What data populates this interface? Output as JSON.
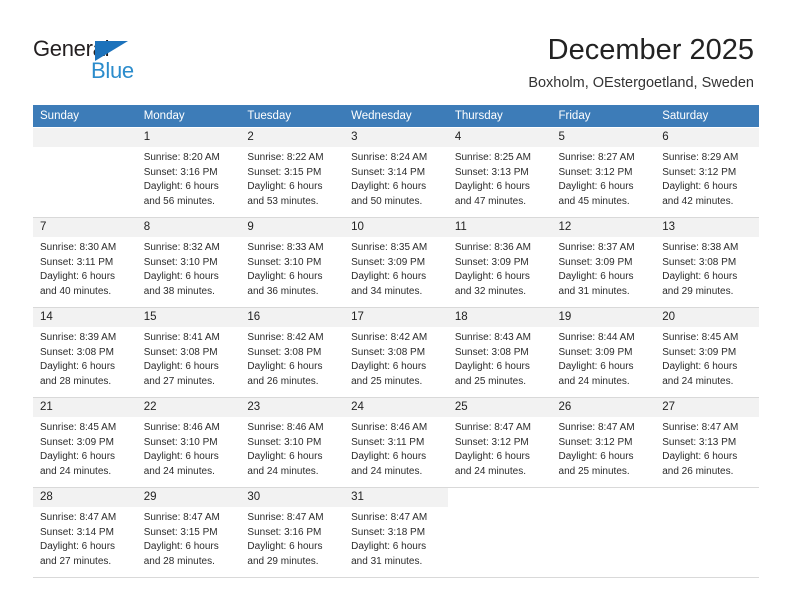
{
  "logo": {
    "text_general": "General",
    "text_blue": "Blue",
    "accent_color": "#1c72bb",
    "blue_text_color": "#2b8ccc"
  },
  "header": {
    "title": "December 2025",
    "subtitle": "Boxholm, OEstergoetland, Sweden"
  },
  "calendar": {
    "header_bg": "#3d7cb8",
    "daynum_bg": "#f2f2f2",
    "weekdays": [
      "Sunday",
      "Monday",
      "Tuesday",
      "Wednesday",
      "Thursday",
      "Friday",
      "Saturday"
    ],
    "weeks": [
      [
        {
          "day": "",
          "lines": []
        },
        {
          "day": "1",
          "lines": [
            "Sunrise: 8:20 AM",
            "Sunset: 3:16 PM",
            "Daylight: 6 hours",
            "and 56 minutes."
          ]
        },
        {
          "day": "2",
          "lines": [
            "Sunrise: 8:22 AM",
            "Sunset: 3:15 PM",
            "Daylight: 6 hours",
            "and 53 minutes."
          ]
        },
        {
          "day": "3",
          "lines": [
            "Sunrise: 8:24 AM",
            "Sunset: 3:14 PM",
            "Daylight: 6 hours",
            "and 50 minutes."
          ]
        },
        {
          "day": "4",
          "lines": [
            "Sunrise: 8:25 AM",
            "Sunset: 3:13 PM",
            "Daylight: 6 hours",
            "and 47 minutes."
          ]
        },
        {
          "day": "5",
          "lines": [
            "Sunrise: 8:27 AM",
            "Sunset: 3:12 PM",
            "Daylight: 6 hours",
            "and 45 minutes."
          ]
        },
        {
          "day": "6",
          "lines": [
            "Sunrise: 8:29 AM",
            "Sunset: 3:12 PM",
            "Daylight: 6 hours",
            "and 42 minutes."
          ]
        }
      ],
      [
        {
          "day": "7",
          "lines": [
            "Sunrise: 8:30 AM",
            "Sunset: 3:11 PM",
            "Daylight: 6 hours",
            "and 40 minutes."
          ]
        },
        {
          "day": "8",
          "lines": [
            "Sunrise: 8:32 AM",
            "Sunset: 3:10 PM",
            "Daylight: 6 hours",
            "and 38 minutes."
          ]
        },
        {
          "day": "9",
          "lines": [
            "Sunrise: 8:33 AM",
            "Sunset: 3:10 PM",
            "Daylight: 6 hours",
            "and 36 minutes."
          ]
        },
        {
          "day": "10",
          "lines": [
            "Sunrise: 8:35 AM",
            "Sunset: 3:09 PM",
            "Daylight: 6 hours",
            "and 34 minutes."
          ]
        },
        {
          "day": "11",
          "lines": [
            "Sunrise: 8:36 AM",
            "Sunset: 3:09 PM",
            "Daylight: 6 hours",
            "and 32 minutes."
          ]
        },
        {
          "day": "12",
          "lines": [
            "Sunrise: 8:37 AM",
            "Sunset: 3:09 PM",
            "Daylight: 6 hours",
            "and 31 minutes."
          ]
        },
        {
          "day": "13",
          "lines": [
            "Sunrise: 8:38 AM",
            "Sunset: 3:08 PM",
            "Daylight: 6 hours",
            "and 29 minutes."
          ]
        }
      ],
      [
        {
          "day": "14",
          "lines": [
            "Sunrise: 8:39 AM",
            "Sunset: 3:08 PM",
            "Daylight: 6 hours",
            "and 28 minutes."
          ]
        },
        {
          "day": "15",
          "lines": [
            "Sunrise: 8:41 AM",
            "Sunset: 3:08 PM",
            "Daylight: 6 hours",
            "and 27 minutes."
          ]
        },
        {
          "day": "16",
          "lines": [
            "Sunrise: 8:42 AM",
            "Sunset: 3:08 PM",
            "Daylight: 6 hours",
            "and 26 minutes."
          ]
        },
        {
          "day": "17",
          "lines": [
            "Sunrise: 8:42 AM",
            "Sunset: 3:08 PM",
            "Daylight: 6 hours",
            "and 25 minutes."
          ]
        },
        {
          "day": "18",
          "lines": [
            "Sunrise: 8:43 AM",
            "Sunset: 3:08 PM",
            "Daylight: 6 hours",
            "and 25 minutes."
          ]
        },
        {
          "day": "19",
          "lines": [
            "Sunrise: 8:44 AM",
            "Sunset: 3:09 PM",
            "Daylight: 6 hours",
            "and 24 minutes."
          ]
        },
        {
          "day": "20",
          "lines": [
            "Sunrise: 8:45 AM",
            "Sunset: 3:09 PM",
            "Daylight: 6 hours",
            "and 24 minutes."
          ]
        }
      ],
      [
        {
          "day": "21",
          "lines": [
            "Sunrise: 8:45 AM",
            "Sunset: 3:09 PM",
            "Daylight: 6 hours",
            "and 24 minutes."
          ]
        },
        {
          "day": "22",
          "lines": [
            "Sunrise: 8:46 AM",
            "Sunset: 3:10 PM",
            "Daylight: 6 hours",
            "and 24 minutes."
          ]
        },
        {
          "day": "23",
          "lines": [
            "Sunrise: 8:46 AM",
            "Sunset: 3:10 PM",
            "Daylight: 6 hours",
            "and 24 minutes."
          ]
        },
        {
          "day": "24",
          "lines": [
            "Sunrise: 8:46 AM",
            "Sunset: 3:11 PM",
            "Daylight: 6 hours",
            "and 24 minutes."
          ]
        },
        {
          "day": "25",
          "lines": [
            "Sunrise: 8:47 AM",
            "Sunset: 3:12 PM",
            "Daylight: 6 hours",
            "and 24 minutes."
          ]
        },
        {
          "day": "26",
          "lines": [
            "Sunrise: 8:47 AM",
            "Sunset: 3:12 PM",
            "Daylight: 6 hours",
            "and 25 minutes."
          ]
        },
        {
          "day": "27",
          "lines": [
            "Sunrise: 8:47 AM",
            "Sunset: 3:13 PM",
            "Daylight: 6 hours",
            "and 26 minutes."
          ]
        }
      ],
      [
        {
          "day": "28",
          "lines": [
            "Sunrise: 8:47 AM",
            "Sunset: 3:14 PM",
            "Daylight: 6 hours",
            "and 27 minutes."
          ]
        },
        {
          "day": "29",
          "lines": [
            "Sunrise: 8:47 AM",
            "Sunset: 3:15 PM",
            "Daylight: 6 hours",
            "and 28 minutes."
          ]
        },
        {
          "day": "30",
          "lines": [
            "Sunrise: 8:47 AM",
            "Sunset: 3:16 PM",
            "Daylight: 6 hours",
            "and 29 minutes."
          ]
        },
        {
          "day": "31",
          "lines": [
            "Sunrise: 8:47 AM",
            "Sunset: 3:18 PM",
            "Daylight: 6 hours",
            "and 31 minutes."
          ]
        },
        {
          "day": "",
          "lines": []
        },
        {
          "day": "",
          "lines": []
        },
        {
          "day": "",
          "lines": []
        }
      ]
    ]
  }
}
